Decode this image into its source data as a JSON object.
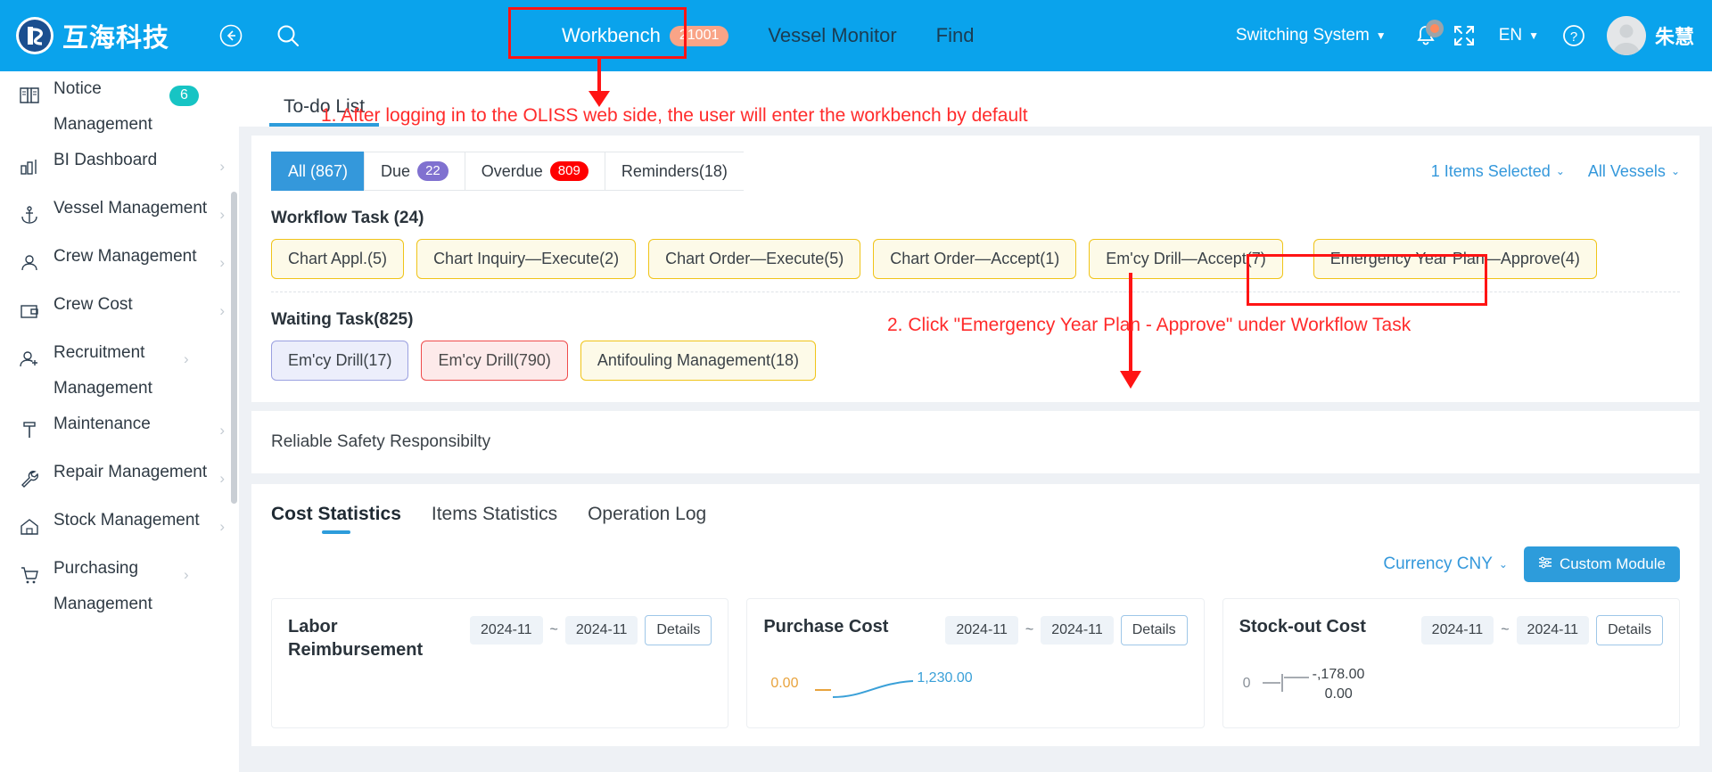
{
  "header": {
    "brand_name": "互海科技",
    "logo_icon": "company-logo-icon",
    "back_icon": "back-arrow-icon",
    "search_icon": "search-icon",
    "nav": [
      {
        "label": "Workbench",
        "badge": "21001",
        "active": true
      },
      {
        "label": "Vessel Monitor",
        "badge": "",
        "active": false
      },
      {
        "label": "Find",
        "badge": "",
        "active": false
      }
    ],
    "switching_system": "Switching System",
    "bell_icon": "notification-bell-icon",
    "fullscreen_icon": "fullscreen-icon",
    "language": "EN",
    "help_icon": "help-question-icon",
    "avatar_icon": "user-avatar-icon",
    "user_name": "朱慧"
  },
  "sidebar": {
    "items": [
      {
        "label": "Notice Management",
        "icon": "book-icon",
        "badge": "6",
        "chevron": false
      },
      {
        "label": "BI Dashboard",
        "icon": "bar-chart-icon",
        "badge": "",
        "chevron": true
      },
      {
        "label": "Vessel Management",
        "icon": "anchor-icon",
        "badge": "",
        "chevron": true
      },
      {
        "label": "Crew Management",
        "icon": "person-icon",
        "badge": "",
        "chevron": true
      },
      {
        "label": "Crew Cost",
        "icon": "wallet-icon",
        "badge": "",
        "chevron": true
      },
      {
        "label": "Recruitment Management",
        "icon": "person-add-icon",
        "badge": "",
        "chevron": true
      },
      {
        "label": "Maintenance",
        "icon": "hammer-icon",
        "badge": "",
        "chevron": true
      },
      {
        "label": "Repair Management",
        "icon": "wrench-icon",
        "badge": "",
        "chevron": true
      },
      {
        "label": "Stock Management",
        "icon": "home-icon",
        "badge": "",
        "chevron": true
      },
      {
        "label": "Purchasing Management",
        "icon": "cart-icon",
        "badge": "",
        "chevron": true
      }
    ]
  },
  "main": {
    "tab_todo": "To-do List",
    "filters": [
      {
        "label": "All (867)",
        "pill": "",
        "pill_color": "",
        "active": true
      },
      {
        "label": "Due",
        "pill": "22",
        "pill_color": "purple",
        "active": false
      },
      {
        "label": "Overdue",
        "pill": "809",
        "pill_color": "red",
        "active": false
      },
      {
        "label": "Reminders(18)",
        "pill": "",
        "pill_color": "",
        "active": false
      }
    ],
    "items_selected": "1 Items Selected",
    "all_vessels": "All Vessels",
    "workflow_title": "Workflow Task (24)",
    "workflow_chips": [
      {
        "label": "Chart Appl.(5)",
        "style": "yellow"
      },
      {
        "label": "Chart Inquiry—Execute(2)",
        "style": "yellow"
      },
      {
        "label": "Chart Order—Execute(5)",
        "style": "yellow"
      },
      {
        "label": "Chart Order—Accept(1)",
        "style": "yellow"
      },
      {
        "label": "Em'cy Drill—Accept(7)",
        "style": "yellow"
      },
      {
        "label": "Emergency Year Plan—Approve(4)",
        "style": "yellow"
      }
    ],
    "waiting_title": "Waiting Task(825)",
    "waiting_chips": [
      {
        "label": "Em'cy Drill(17)",
        "style": "blue"
      },
      {
        "label": "Em'cy Drill(790)",
        "style": "red"
      },
      {
        "label": "Antifouling Management(18)",
        "style": "yellow"
      }
    ],
    "responsibility": "Reliable Safety Responsibilty"
  },
  "stats": {
    "tabs": [
      {
        "label": "Cost Statistics",
        "active": true
      },
      {
        "label": "Items Statistics",
        "active": false
      },
      {
        "label": "Operation Log",
        "active": false
      }
    ],
    "currency": "Currency CNY",
    "custom_module": "Custom Module",
    "custom_module_icon": "sliders-icon",
    "cards": [
      {
        "title": "Labor Reimbursement",
        "date_from": "2024-11",
        "date_to": "2024-11",
        "details": "Details",
        "values": []
      },
      {
        "title": "Purchase Cost",
        "date_from": "2024-11",
        "date_to": "2024-11",
        "details": "Details",
        "values": [
          "0.00",
          "1,230.00"
        ]
      },
      {
        "title": "Stock-out Cost",
        "date_from": "2024-11",
        "date_to": "2024-11",
        "details": "Details",
        "values": [
          "0",
          "-,178.00",
          "0.00"
        ]
      }
    ]
  },
  "annotations": {
    "step1": "1. After logging in to the OLISS web side, the user will enter the workbench by default",
    "step2": "2. Click \"Emergency Year Plan - Approve\" under Workflow Task",
    "color": "#ff2b2b"
  }
}
